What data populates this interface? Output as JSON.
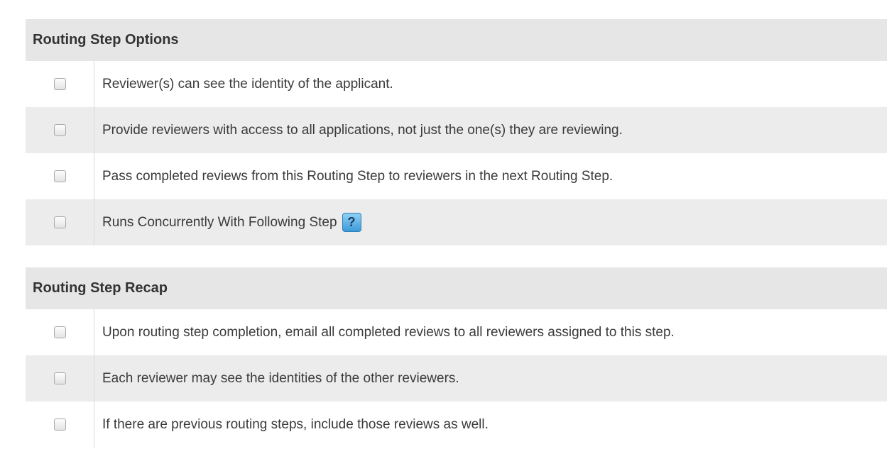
{
  "routing_step_options": {
    "title": "Routing Step Options",
    "items": [
      {
        "label": "Reviewer(s) can see the identity of the applicant.",
        "checked": false
      },
      {
        "label": "Provide reviewers with access to all applications, not just the one(s) they are reviewing.",
        "checked": false
      },
      {
        "label": "Pass completed reviews from this Routing Step to reviewers in the next Routing Step.",
        "checked": false
      },
      {
        "label": "Runs Concurrently With Following Step",
        "checked": false,
        "help_icon": "question-mark-icon",
        "help_glyph": "?"
      }
    ]
  },
  "routing_step_recap": {
    "title": "Routing Step Recap",
    "items": [
      {
        "label": "Upon routing step completion, email all completed reviews to all reviewers assigned to this step.",
        "checked": false
      },
      {
        "label": "Each reviewer may see the identities of the other reviewers.",
        "checked": false
      },
      {
        "label": "If there are previous routing steps, include those reviews as well.",
        "checked": false
      }
    ]
  },
  "colors": {
    "header_bg": "#e6e6e6",
    "row_alt_bg": "#ececec",
    "help_icon_bg": "#3c9ad8"
  }
}
